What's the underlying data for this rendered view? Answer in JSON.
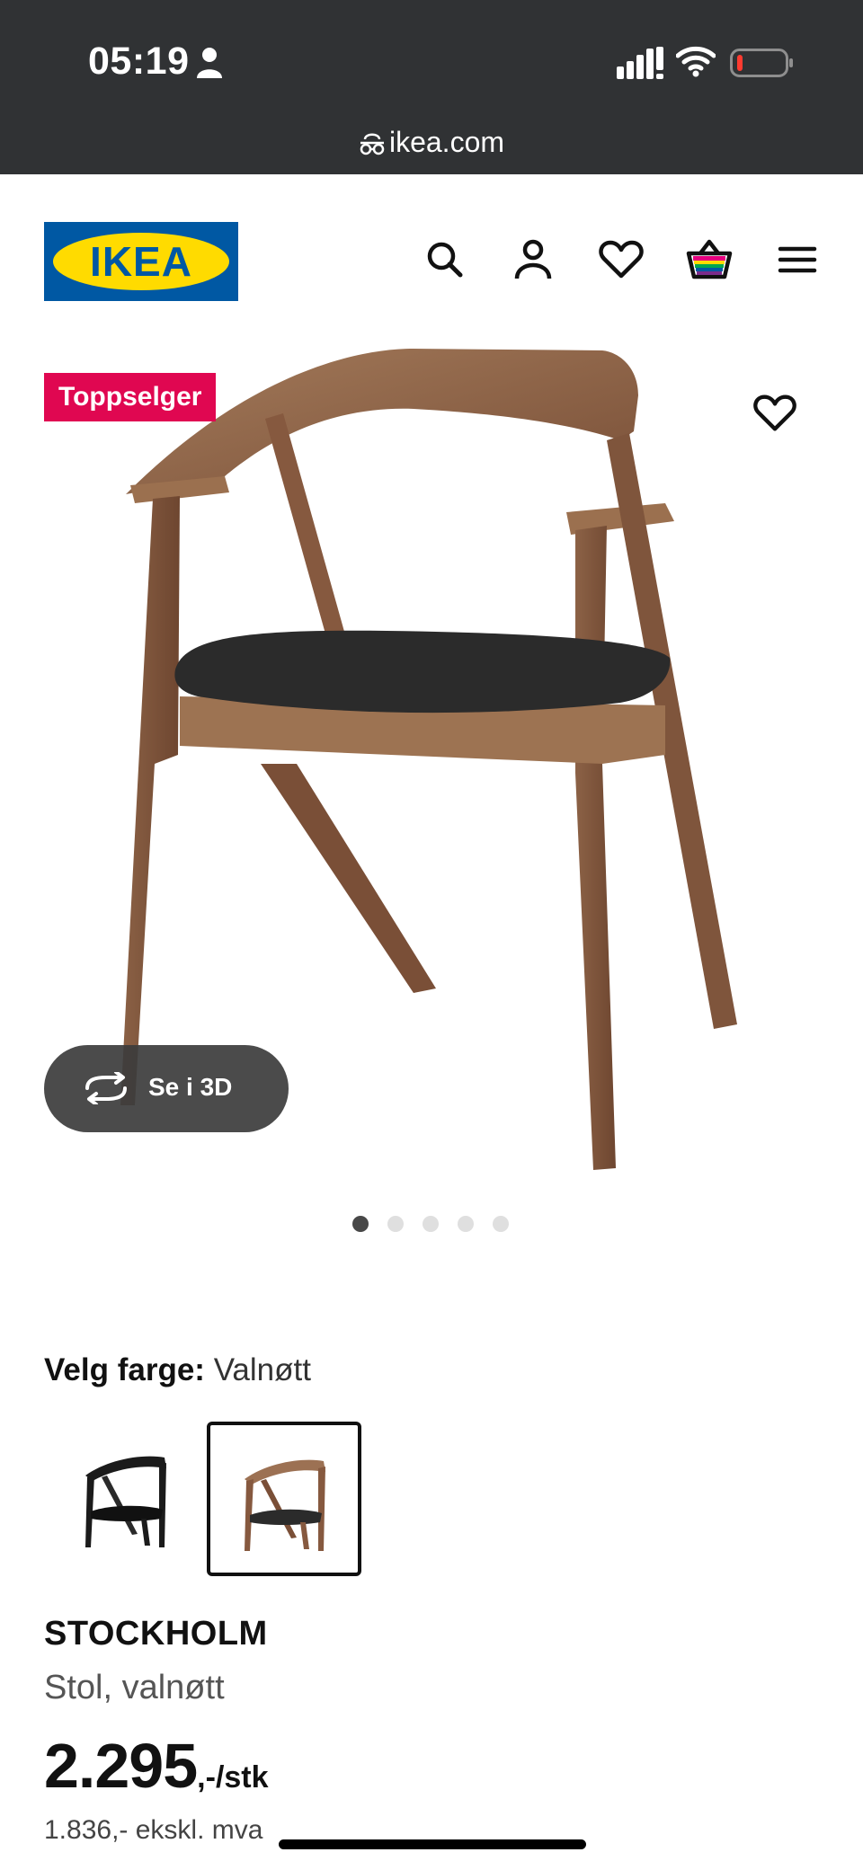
{
  "status_bar": {
    "time": "05:19",
    "icons": [
      "person-icon",
      "signal-icon",
      "wifi-icon",
      "battery-icon"
    ]
  },
  "browser": {
    "url": "ikea.com"
  },
  "header": {
    "logo_text": "IKEA",
    "icons": [
      "search-icon",
      "account-icon",
      "favorites-icon",
      "cart-icon",
      "menu-icon"
    ]
  },
  "product_media": {
    "badge": "Toppselger",
    "view_3d_label": "Se i 3D",
    "image_count": 5,
    "active_image": 1
  },
  "color_selector": {
    "label": "Velg farge:",
    "value": "Valnøtt",
    "options": [
      "black",
      "walnut"
    ],
    "selected": "walnut"
  },
  "product": {
    "name": "STOCKHOLM",
    "description": "Stol, valnøtt",
    "price_main": "2.295",
    "price_suffix": ",-/stk",
    "price_ex_vat": "1.836,- ekskl. mva"
  },
  "colors": {
    "top_bar": "#303234",
    "badge": "#e00751",
    "ikea_blue": "#0058a3",
    "ikea_yellow": "#ffdb00"
  }
}
